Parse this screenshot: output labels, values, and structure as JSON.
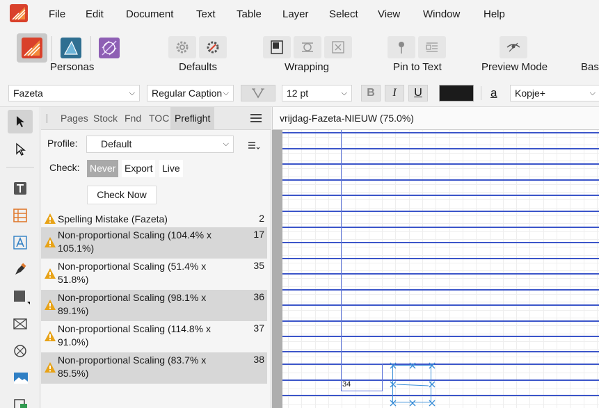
{
  "menu": {
    "items": [
      "File",
      "Edit",
      "Document",
      "Text",
      "Table",
      "Layer",
      "Select",
      "View",
      "Window",
      "Help"
    ]
  },
  "toolbar": {
    "personas_label": "Personas",
    "defaults_label": "Defaults",
    "wrapping_label": "Wrapping",
    "pin_label": "Pin to Text",
    "preview_label": "Preview Mode",
    "base_label": "Base"
  },
  "context": {
    "font_family": "Fazeta",
    "font_style": "Regular Caption",
    "font_size": "12 pt",
    "bold_label": "B",
    "italic_label": "I",
    "underline_label": "U",
    "char_style_glyph": "a",
    "paragraph_style": "Kopje+",
    "text_color": "#1b1b1b"
  },
  "panel": {
    "tabs": [
      "Pages",
      "Stock",
      "Fnd",
      "TOC",
      "Preflight"
    ],
    "active_tab": "Preflight",
    "profile_label": "Profile:",
    "profile_value": "Default",
    "check_label": "Check:",
    "check_options": [
      "Never",
      "Export",
      "Live"
    ],
    "check_selected": "Never",
    "check_now_label": "Check Now",
    "results": [
      {
        "text": "Spelling Mistake (Fazeta)",
        "count": "2"
      },
      {
        "text": "Non-proportional Scaling (104.4% x 105.1%)",
        "count": "17"
      },
      {
        "text": "Non-proportional Scaling (51.4% x 51.8%)",
        "count": "35"
      },
      {
        "text": "Non-proportional Scaling (98.1% x 89.1%)",
        "count": "36"
      },
      {
        "text": "Non-proportional Scaling (114.8% x 91.0%)",
        "count": "37"
      },
      {
        "text": "Non-proportional Scaling (83.7% x 85.5%)",
        "count": "38"
      }
    ]
  },
  "document": {
    "tab_title": "vrijdag-Fazeta-NIEUW (75.0%)",
    "frame_number": "34"
  },
  "colors": {
    "accent_blue": "#3b55c9",
    "warning": "#e8a317",
    "publisher_brand": "#d9412b",
    "designer_brand": "#2f6f91",
    "photo_brand": "#8e5fb4"
  }
}
